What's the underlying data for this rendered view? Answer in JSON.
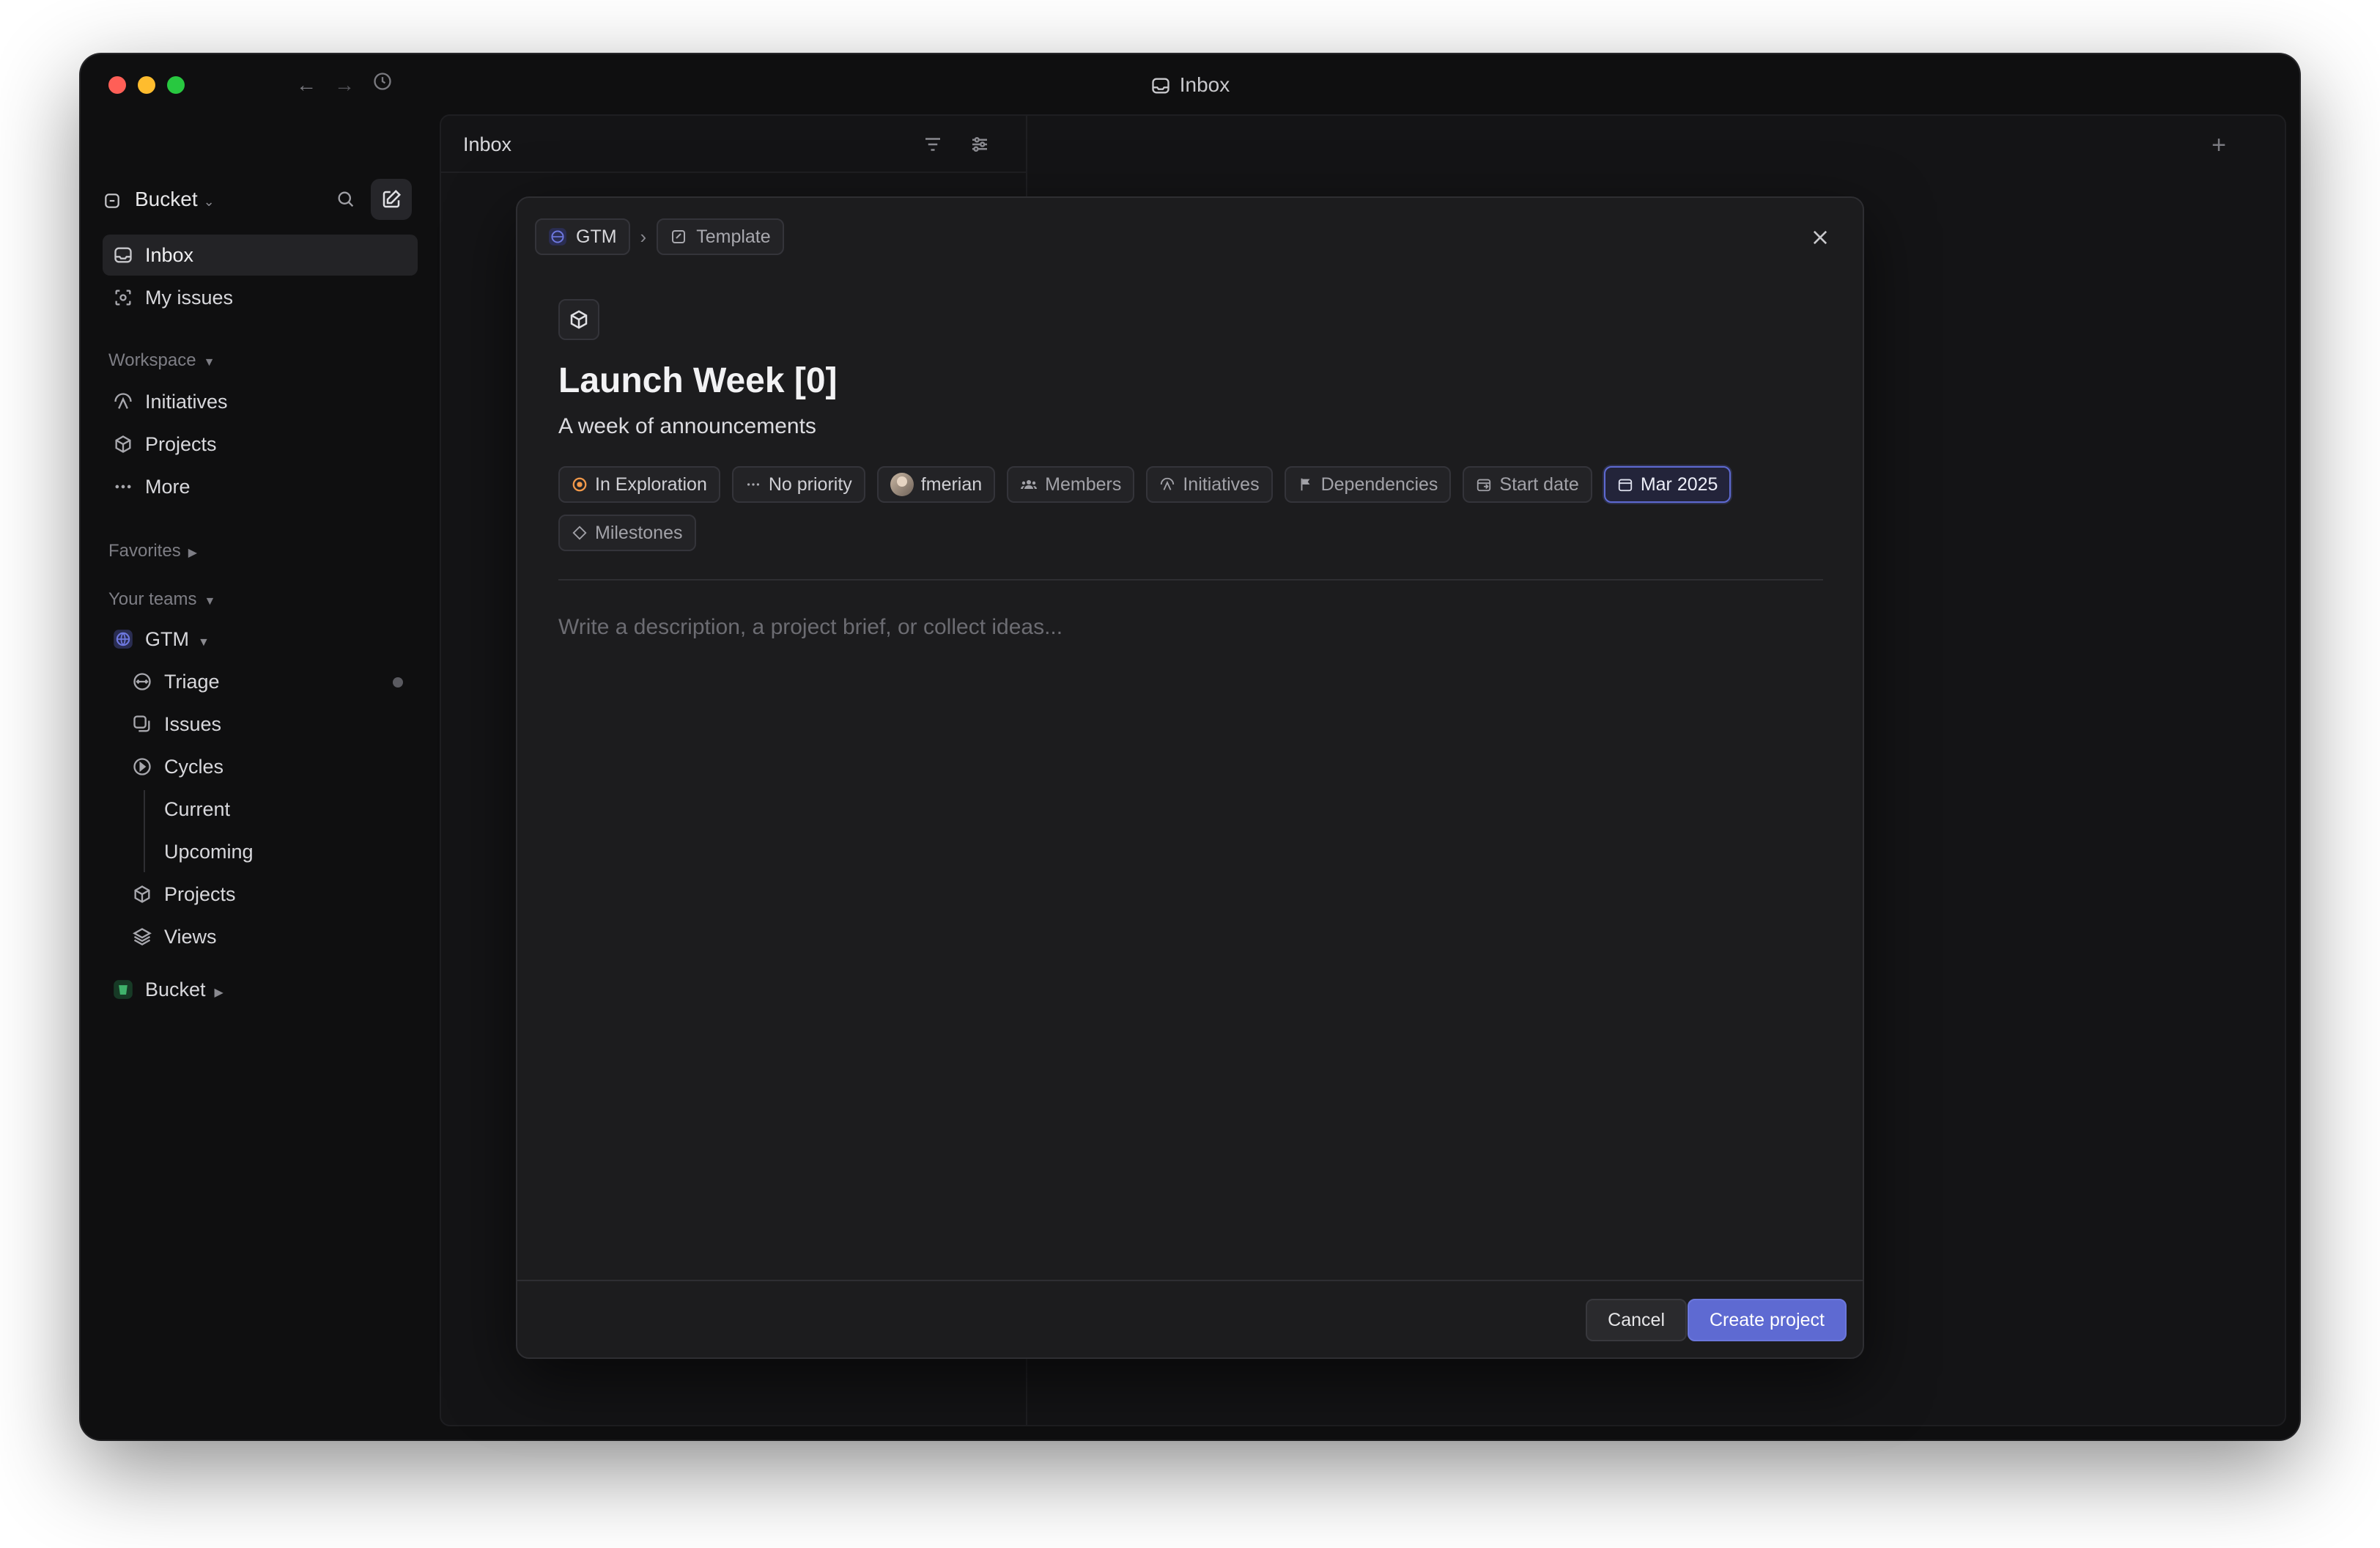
{
  "window": {
    "title": "Inbox"
  },
  "sidebar": {
    "workspace_name": "Bucket",
    "top_items": [
      {
        "label": "Inbox",
        "icon": "inbox-icon"
      },
      {
        "label": "My issues",
        "icon": "my-issues-icon"
      }
    ],
    "workspace_section": {
      "label": "Workspace",
      "items": [
        {
          "label": "Initiatives",
          "icon": "initiatives-icon"
        },
        {
          "label": "Projects",
          "icon": "projects-icon"
        },
        {
          "label": "More",
          "icon": "more-icon"
        }
      ]
    },
    "favorites_label": "Favorites",
    "teams_label": "Your teams",
    "team_gtm": {
      "label": "GTM",
      "items": [
        {
          "label": "Triage",
          "icon": "triage-icon"
        },
        {
          "label": "Issues",
          "icon": "issues-icon"
        },
        {
          "label": "Cycles",
          "icon": "cycles-icon"
        },
        {
          "label": "Current"
        },
        {
          "label": "Upcoming"
        },
        {
          "label": "Projects",
          "icon": "projects-icon"
        },
        {
          "label": "Views",
          "icon": "views-icon"
        }
      ]
    },
    "team_bucket": {
      "label": "Bucket"
    },
    "help_label": "?"
  },
  "inbox": {
    "title": "Inbox"
  },
  "modal": {
    "breadcrumb": {
      "team": "GTM",
      "template": "Template"
    },
    "title": "Launch Week [0]",
    "summary": "A week of announcements",
    "properties": [
      {
        "key": "status",
        "label": "In Exploration"
      },
      {
        "key": "priority",
        "label": "No priority"
      },
      {
        "key": "lead",
        "label": "fmerian"
      },
      {
        "key": "members",
        "label": "Members"
      },
      {
        "key": "initiatives",
        "label": "Initiatives"
      },
      {
        "key": "dependencies",
        "label": "Dependencies"
      },
      {
        "key": "start_date",
        "label": "Start date"
      },
      {
        "key": "target_date",
        "label": "Mar 2025"
      },
      {
        "key": "milestones",
        "label": "Milestones"
      }
    ],
    "description_placeholder": "Write a description, a project brief, or collect ideas...",
    "cancel_label": "Cancel",
    "create_label": "Create project"
  },
  "colors": {
    "accent": "#5e6ad2",
    "status": "#f2994a",
    "background": "#0f0f10"
  }
}
